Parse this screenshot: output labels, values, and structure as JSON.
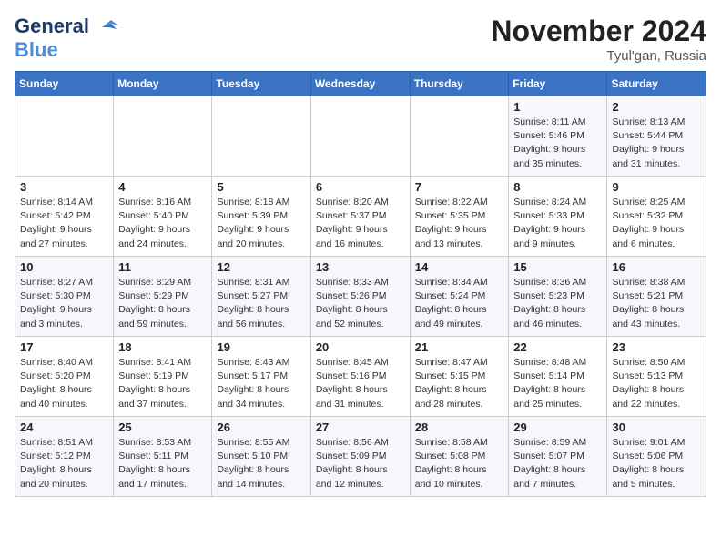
{
  "logo": {
    "line1": "General",
    "line2": "Blue"
  },
  "title": "November 2024",
  "location": "Tyul'gan, Russia",
  "days_header": [
    "Sunday",
    "Monday",
    "Tuesday",
    "Wednesday",
    "Thursday",
    "Friday",
    "Saturday"
  ],
  "weeks": [
    [
      {
        "day": "",
        "info": ""
      },
      {
        "day": "",
        "info": ""
      },
      {
        "day": "",
        "info": ""
      },
      {
        "day": "",
        "info": ""
      },
      {
        "day": "",
        "info": ""
      },
      {
        "day": "1",
        "info": "Sunrise: 8:11 AM\nSunset: 5:46 PM\nDaylight: 9 hours\nand 35 minutes."
      },
      {
        "day": "2",
        "info": "Sunrise: 8:13 AM\nSunset: 5:44 PM\nDaylight: 9 hours\nand 31 minutes."
      }
    ],
    [
      {
        "day": "3",
        "info": "Sunrise: 8:14 AM\nSunset: 5:42 PM\nDaylight: 9 hours\nand 27 minutes."
      },
      {
        "day": "4",
        "info": "Sunrise: 8:16 AM\nSunset: 5:40 PM\nDaylight: 9 hours\nand 24 minutes."
      },
      {
        "day": "5",
        "info": "Sunrise: 8:18 AM\nSunset: 5:39 PM\nDaylight: 9 hours\nand 20 minutes."
      },
      {
        "day": "6",
        "info": "Sunrise: 8:20 AM\nSunset: 5:37 PM\nDaylight: 9 hours\nand 16 minutes."
      },
      {
        "day": "7",
        "info": "Sunrise: 8:22 AM\nSunset: 5:35 PM\nDaylight: 9 hours\nand 13 minutes."
      },
      {
        "day": "8",
        "info": "Sunrise: 8:24 AM\nSunset: 5:33 PM\nDaylight: 9 hours\nand 9 minutes."
      },
      {
        "day": "9",
        "info": "Sunrise: 8:25 AM\nSunset: 5:32 PM\nDaylight: 9 hours\nand 6 minutes."
      }
    ],
    [
      {
        "day": "10",
        "info": "Sunrise: 8:27 AM\nSunset: 5:30 PM\nDaylight: 9 hours\nand 3 minutes."
      },
      {
        "day": "11",
        "info": "Sunrise: 8:29 AM\nSunset: 5:29 PM\nDaylight: 8 hours\nand 59 minutes."
      },
      {
        "day": "12",
        "info": "Sunrise: 8:31 AM\nSunset: 5:27 PM\nDaylight: 8 hours\nand 56 minutes."
      },
      {
        "day": "13",
        "info": "Sunrise: 8:33 AM\nSunset: 5:26 PM\nDaylight: 8 hours\nand 52 minutes."
      },
      {
        "day": "14",
        "info": "Sunrise: 8:34 AM\nSunset: 5:24 PM\nDaylight: 8 hours\nand 49 minutes."
      },
      {
        "day": "15",
        "info": "Sunrise: 8:36 AM\nSunset: 5:23 PM\nDaylight: 8 hours\nand 46 minutes."
      },
      {
        "day": "16",
        "info": "Sunrise: 8:38 AM\nSunset: 5:21 PM\nDaylight: 8 hours\nand 43 minutes."
      }
    ],
    [
      {
        "day": "17",
        "info": "Sunrise: 8:40 AM\nSunset: 5:20 PM\nDaylight: 8 hours\nand 40 minutes."
      },
      {
        "day": "18",
        "info": "Sunrise: 8:41 AM\nSunset: 5:19 PM\nDaylight: 8 hours\nand 37 minutes."
      },
      {
        "day": "19",
        "info": "Sunrise: 8:43 AM\nSunset: 5:17 PM\nDaylight: 8 hours\nand 34 minutes."
      },
      {
        "day": "20",
        "info": "Sunrise: 8:45 AM\nSunset: 5:16 PM\nDaylight: 8 hours\nand 31 minutes."
      },
      {
        "day": "21",
        "info": "Sunrise: 8:47 AM\nSunset: 5:15 PM\nDaylight: 8 hours\nand 28 minutes."
      },
      {
        "day": "22",
        "info": "Sunrise: 8:48 AM\nSunset: 5:14 PM\nDaylight: 8 hours\nand 25 minutes."
      },
      {
        "day": "23",
        "info": "Sunrise: 8:50 AM\nSunset: 5:13 PM\nDaylight: 8 hours\nand 22 minutes."
      }
    ],
    [
      {
        "day": "24",
        "info": "Sunrise: 8:51 AM\nSunset: 5:12 PM\nDaylight: 8 hours\nand 20 minutes."
      },
      {
        "day": "25",
        "info": "Sunrise: 8:53 AM\nSunset: 5:11 PM\nDaylight: 8 hours\nand 17 minutes."
      },
      {
        "day": "26",
        "info": "Sunrise: 8:55 AM\nSunset: 5:10 PM\nDaylight: 8 hours\nand 14 minutes."
      },
      {
        "day": "27",
        "info": "Sunrise: 8:56 AM\nSunset: 5:09 PM\nDaylight: 8 hours\nand 12 minutes."
      },
      {
        "day": "28",
        "info": "Sunrise: 8:58 AM\nSunset: 5:08 PM\nDaylight: 8 hours\nand 10 minutes."
      },
      {
        "day": "29",
        "info": "Sunrise: 8:59 AM\nSunset: 5:07 PM\nDaylight: 8 hours\nand 7 minutes."
      },
      {
        "day": "30",
        "info": "Sunrise: 9:01 AM\nSunset: 5:06 PM\nDaylight: 8 hours\nand 5 minutes."
      }
    ]
  ]
}
